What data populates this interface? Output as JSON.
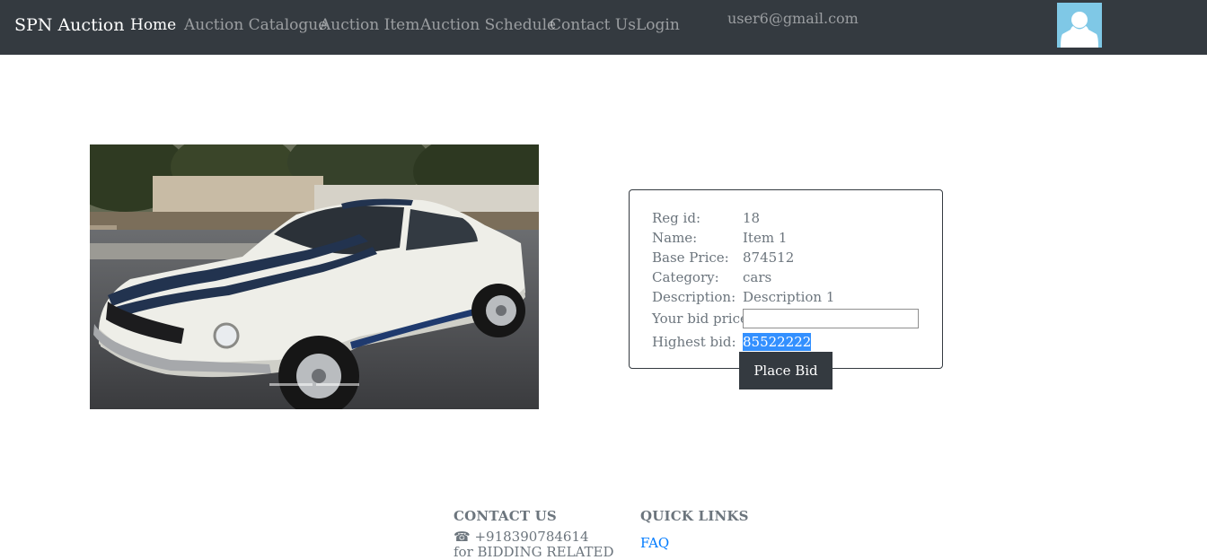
{
  "navbar": {
    "brand": "SPN Auction",
    "links": [
      "Home",
      "Auction Catalogue",
      "Auction Item",
      "Auction Schedule",
      "Contact Us",
      "Login"
    ],
    "active_index": 0,
    "user_email": "user6@gmail.com",
    "avatar_icon": "user-avatar-icon"
  },
  "item": {
    "image_icon": "car-photo",
    "details": [
      {
        "label": "Reg id:",
        "value": "18"
      },
      {
        "label": "Name:",
        "value": "Item 1"
      },
      {
        "label": "Base Price:",
        "value": "874512"
      },
      {
        "label": "Category:",
        "value": "cars"
      },
      {
        "label": "Description:",
        "value": "Description 1"
      }
    ],
    "bid_label": "Your bid price:",
    "bid_value": "",
    "highest_label": "Highest bid:",
    "highest_value": "85522222",
    "place_bid_label": "Place Bid"
  },
  "footer": {
    "contact_heading": "CONTACT US",
    "phone_icon": "phone-icon",
    "phone": "☎ +918390784614",
    "contact_note": "for BIDDING RELATED",
    "links_heading": "QUICK LINKS",
    "faq": "FAQ"
  },
  "colors": {
    "navbar_bg": "#343a40",
    "link_blue": "#007bff",
    "selection_blue": "#3390ff",
    "avatar_bg": "#7fc8e6"
  }
}
